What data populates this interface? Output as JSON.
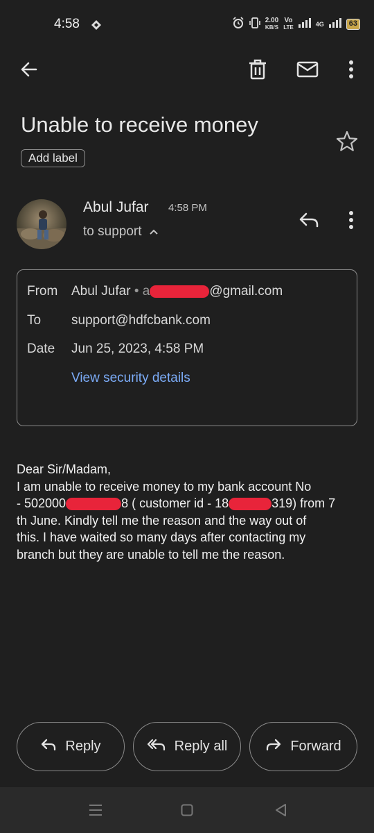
{
  "status_bar": {
    "time": "4:58",
    "speed_value": "2.00",
    "speed_unit": "KB/S",
    "volte_top": "Vo",
    "volte_bottom": "LTE",
    "network": "4G",
    "battery": "63"
  },
  "toolbar": {
    "icons": [
      "back-arrow-icon",
      "delete-icon",
      "mark-unread-icon",
      "more-vert-icon"
    ]
  },
  "email": {
    "subject": "Unable to receive money",
    "add_label": "Add label",
    "sender_name": "Abul Jufar",
    "time": "4:58 PM",
    "to_summary": "to support",
    "details": {
      "from_label": "From",
      "from_name": "Abul Jufar",
      "from_domain": "@gmail.com",
      "to_label": "To",
      "to_value": "support@hdfcbank.com",
      "date_label": "Date",
      "date_value": "Jun 25, 2023, 4:58 PM",
      "security_link": "View security details"
    },
    "body": {
      "greeting": "Dear Sir/Madam,",
      "line2_a": "I am unable to receive money to my bank account No",
      "line3_a": "- 502000",
      "line3_b": "8 ( customer id - 18",
      "line3_c": "319) from 7",
      "line4": "th June. Kindly tell me the reason and the way out of",
      "line5": "this. I have waited so many days after contacting my",
      "line6": "branch but they are unable to tell me the reason."
    }
  },
  "actions": {
    "reply": "Reply",
    "reply_all": "Reply all",
    "forward": "Forward"
  },
  "colors": {
    "background": "#1f1f1f",
    "link": "#7cacf8",
    "redaction": "#e8243a"
  }
}
